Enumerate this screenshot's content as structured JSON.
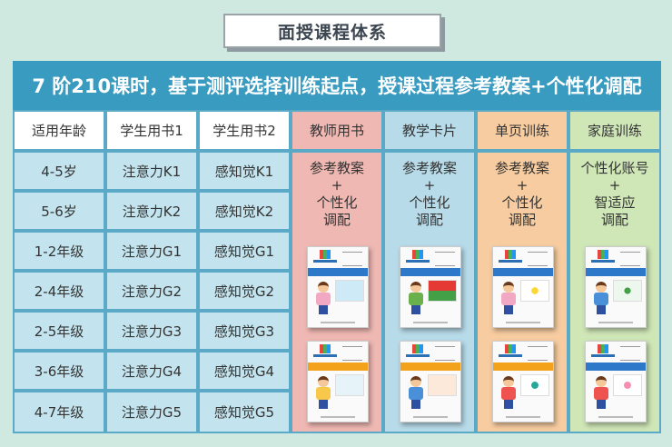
{
  "title": "面授课程体系",
  "table": {
    "header": "7 阶210课时，基于测评选择训练起点，授课过程参考教案+个性化调配",
    "columns": [
      "适用年龄",
      "学生用书1",
      "学生用书2",
      "教师用书",
      "教学卡片",
      "单页训练",
      "家庭训练"
    ],
    "rows": [
      {
        "age": "4-5岁",
        "book1": "注意力K1",
        "book2": "感知觉K1"
      },
      {
        "age": "5-6岁",
        "book1": "注意力K2",
        "book2": "感知觉K2"
      },
      {
        "age": "1-2年级",
        "book1": "注意力G1",
        "book2": "感知觉G1"
      },
      {
        "age": "2-4年级",
        "book1": "注意力G2",
        "book2": "感知觉G2"
      },
      {
        "age": "2-5年级",
        "book1": "注意力G3",
        "book2": "感知觉G3"
      },
      {
        "age": "3-6年级",
        "book1": "注意力G4",
        "book2": "感知觉G4"
      },
      {
        "age": "4-7年级",
        "book1": "注意力G5",
        "book2": "感知觉G5"
      }
    ],
    "resources": [
      {
        "line1": "参考教案",
        "line2": "+",
        "line3": "个性化",
        "line4": "调配"
      },
      {
        "line1": "参考教案",
        "line2": "+",
        "line3": "个性化",
        "line4": "调配"
      },
      {
        "line1": "参考教案",
        "line2": "+",
        "line3": "个性化",
        "line4": "调配"
      },
      {
        "line1": "个性化账号",
        "line2": "+",
        "line3": "智适应",
        "line4": "调配"
      }
    ]
  },
  "colors": {
    "header": "#3a9bc0",
    "teacher": "#efb8b3",
    "card": "#b8dbe9",
    "single": "#f7cca0",
    "home": "#cfe6b7"
  }
}
